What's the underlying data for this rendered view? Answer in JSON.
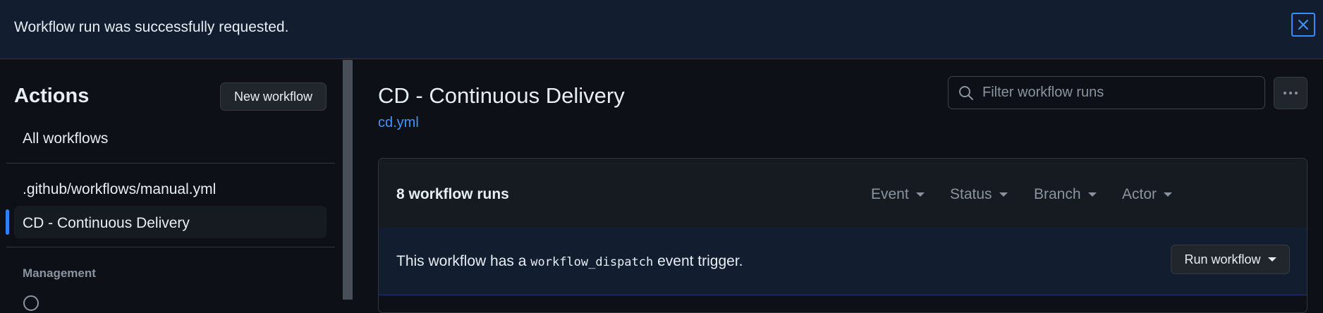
{
  "flash": {
    "message": "Workflow run was successfully requested.",
    "close_icon": "close-icon"
  },
  "sidebar": {
    "title": "Actions",
    "new_workflow_label": "New workflow",
    "all_workflows_label": "All workflows",
    "workflows": [
      {
        "label": ".github/workflows/manual.yml",
        "active": false
      },
      {
        "label": "CD - Continuous Delivery",
        "active": true
      }
    ],
    "section_label": "Management"
  },
  "main": {
    "title": "CD - Continuous Delivery",
    "file_link": "cd.yml",
    "search": {
      "placeholder": "Filter workflow runs",
      "value": ""
    },
    "more_icon": "kebab-horizontal-icon",
    "runs": {
      "count_label": "8 workflow runs",
      "filters": [
        "Event",
        "Status",
        "Branch",
        "Actor"
      ],
      "dispatch": {
        "prefix": "This workflow has a",
        "code": "workflow_dispatch",
        "suffix": "event trigger.",
        "button_label": "Run workflow"
      }
    }
  },
  "colors": {
    "background": "#0d1117",
    "flash_background": "#121d2f",
    "accent": "#2f81f7",
    "link": "#4493f8",
    "muted": "#8b949e"
  }
}
